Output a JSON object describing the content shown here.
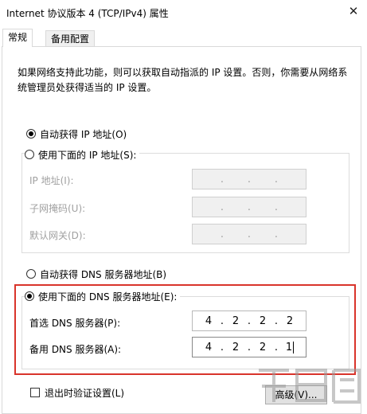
{
  "window": {
    "title": "Internet 协议版本 4 (TCP/IPv4) 属性",
    "close_glyph": "✕"
  },
  "tabs": [
    {
      "label": "常规",
      "selected": true
    },
    {
      "label": "备用配置",
      "selected": false
    }
  ],
  "description": "如果网络支持此功能，则可以获取自动指派的 IP 设置。否则，你需要从网络系统管理员处获得适当的 IP 设置。",
  "ip_section": {
    "auto_option": "自动获得 IP 地址(O)",
    "manual_option": "使用下面的 IP 地址(S):",
    "selected": "auto",
    "fields": [
      {
        "label": "IP 地址(I):",
        "octets": [
          "",
          "",
          "",
          ""
        ]
      },
      {
        "label": "子网掩码(U):",
        "octets": [
          "",
          "",
          "",
          ""
        ]
      },
      {
        "label": "默认网关(D):",
        "octets": [
          "",
          "",
          "",
          ""
        ]
      }
    ]
  },
  "dns_section": {
    "auto_option": "自动获得 DNS 服务器地址(B)",
    "manual_option": "使用下面的 DNS 服务器地址(E):",
    "selected": "manual",
    "preferred": {
      "label": "首选 DNS 服务器(P):",
      "octets": [
        "4",
        "2",
        "2",
        "2"
      ]
    },
    "alternate": {
      "label": "备用 DNS 服务器(A):",
      "octets": [
        "4",
        "2",
        "2",
        "1"
      ]
    }
  },
  "footer": {
    "validate_checkbox": "退出时验证设置(L)",
    "validate_checked": false,
    "advanced_button": "高级(V)..."
  },
  "colors": {
    "highlight": "#d9342b",
    "disabled_text": "#a0a0a0"
  }
}
